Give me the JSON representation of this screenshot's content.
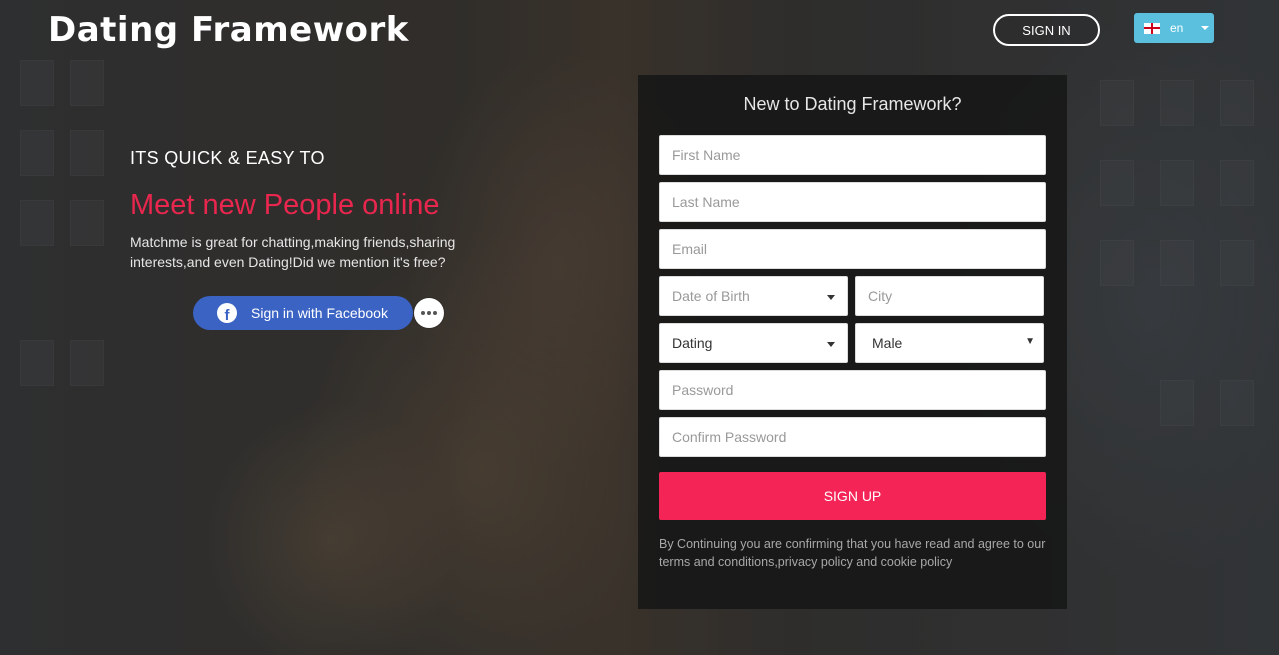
{
  "header": {
    "logo": "Dating Framework",
    "sign_in_label": "SIGN IN",
    "language": {
      "code": "en",
      "flag": "england-flag-icon"
    }
  },
  "hero": {
    "kicker": "ITS QUICK & EASY TO",
    "headline": "Meet new People online",
    "description": "Matchme is great for chatting,making friends,sharing interests,and even Dating!Did we mention it's free?",
    "facebook_label": "Sign in with Facebook",
    "more_icon": "more-options-icon"
  },
  "form": {
    "title": "New to Dating Framework?",
    "first_name_placeholder": "First Name",
    "last_name_placeholder": "Last Name",
    "email_placeholder": "Email",
    "dob_placeholder": "Date of Birth",
    "city_placeholder": "City",
    "looking_for_value": "Dating",
    "gender_value": "Male",
    "password_placeholder": "Password",
    "confirm_password_placeholder": "Confirm Password",
    "submit_label": "SIGN UP",
    "terms": "By Continuing you are confirming that you have read and agree to our terms and conditions,privacy policy and cookie policy"
  },
  "colors": {
    "accent": "#f42457",
    "headline": "#e8264e",
    "facebook": "#3b63c4",
    "language_button": "#5bc0de"
  }
}
